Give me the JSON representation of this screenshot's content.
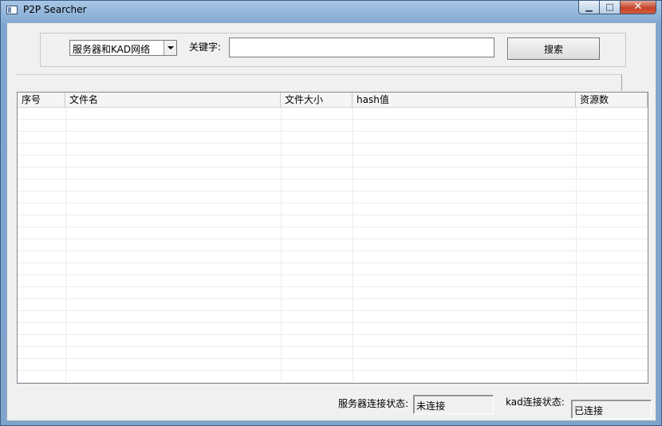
{
  "window": {
    "title": "P2P Searcher",
    "controls": {
      "minimize": "▁",
      "maximize": "□",
      "close": "✕"
    }
  },
  "search": {
    "network_selected": "服务器和KAD网络",
    "keyword_label": "关键字:",
    "keyword_value": "",
    "button_label": "搜索"
  },
  "results": {
    "columns": [
      "序号",
      "文件名",
      "文件大小",
      "hash值",
      "资源数"
    ],
    "rows": []
  },
  "status": {
    "server_label": "服务器连接状态:",
    "server_value": "未连接",
    "kad_label": "kad连接状态:",
    "kad_value": "已连接"
  }
}
